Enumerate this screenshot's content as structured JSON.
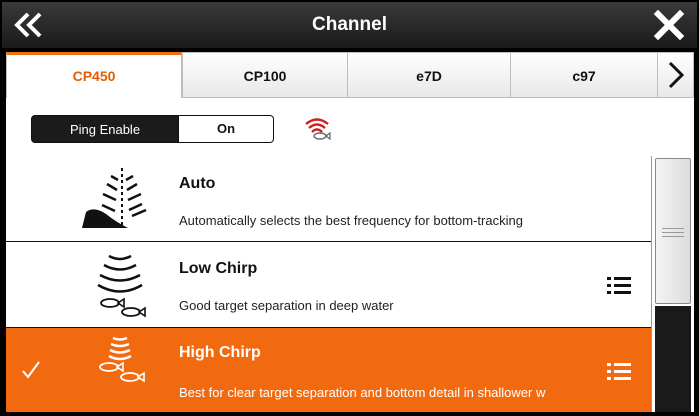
{
  "window": {
    "title": "Channel",
    "back_icon": "double-chevron-left-icon",
    "close_icon": "close-icon"
  },
  "tabs": [
    {
      "label": "CP450",
      "active": true
    },
    {
      "label": "CP100",
      "active": false
    },
    {
      "label": "e7D",
      "active": false
    },
    {
      "label": "c97",
      "active": false
    }
  ],
  "tabs_next_icon": "chevron-right-icon",
  "ping": {
    "label": "Ping Enable",
    "value": "On",
    "icon": "sonar-ping-icon"
  },
  "items": [
    {
      "name": "Auto",
      "description": "Automatically selects the best frequency for bottom-tracking",
      "icon": "auto-sonar-icon",
      "selected": false,
      "has_options": false
    },
    {
      "name": "Low Chirp",
      "description": "Good target separation in deep water",
      "icon": "low-chirp-icon",
      "selected": false,
      "has_options": true
    },
    {
      "name": "High Chirp",
      "description": "Best for clear target separation and bottom detail in shallower w",
      "icon": "high-chirp-icon",
      "selected": true,
      "has_options": true
    }
  ],
  "colors": {
    "accent": "#f26a10",
    "titlebar": "#2a2a2a",
    "active_tab_text": "#e45d00"
  }
}
